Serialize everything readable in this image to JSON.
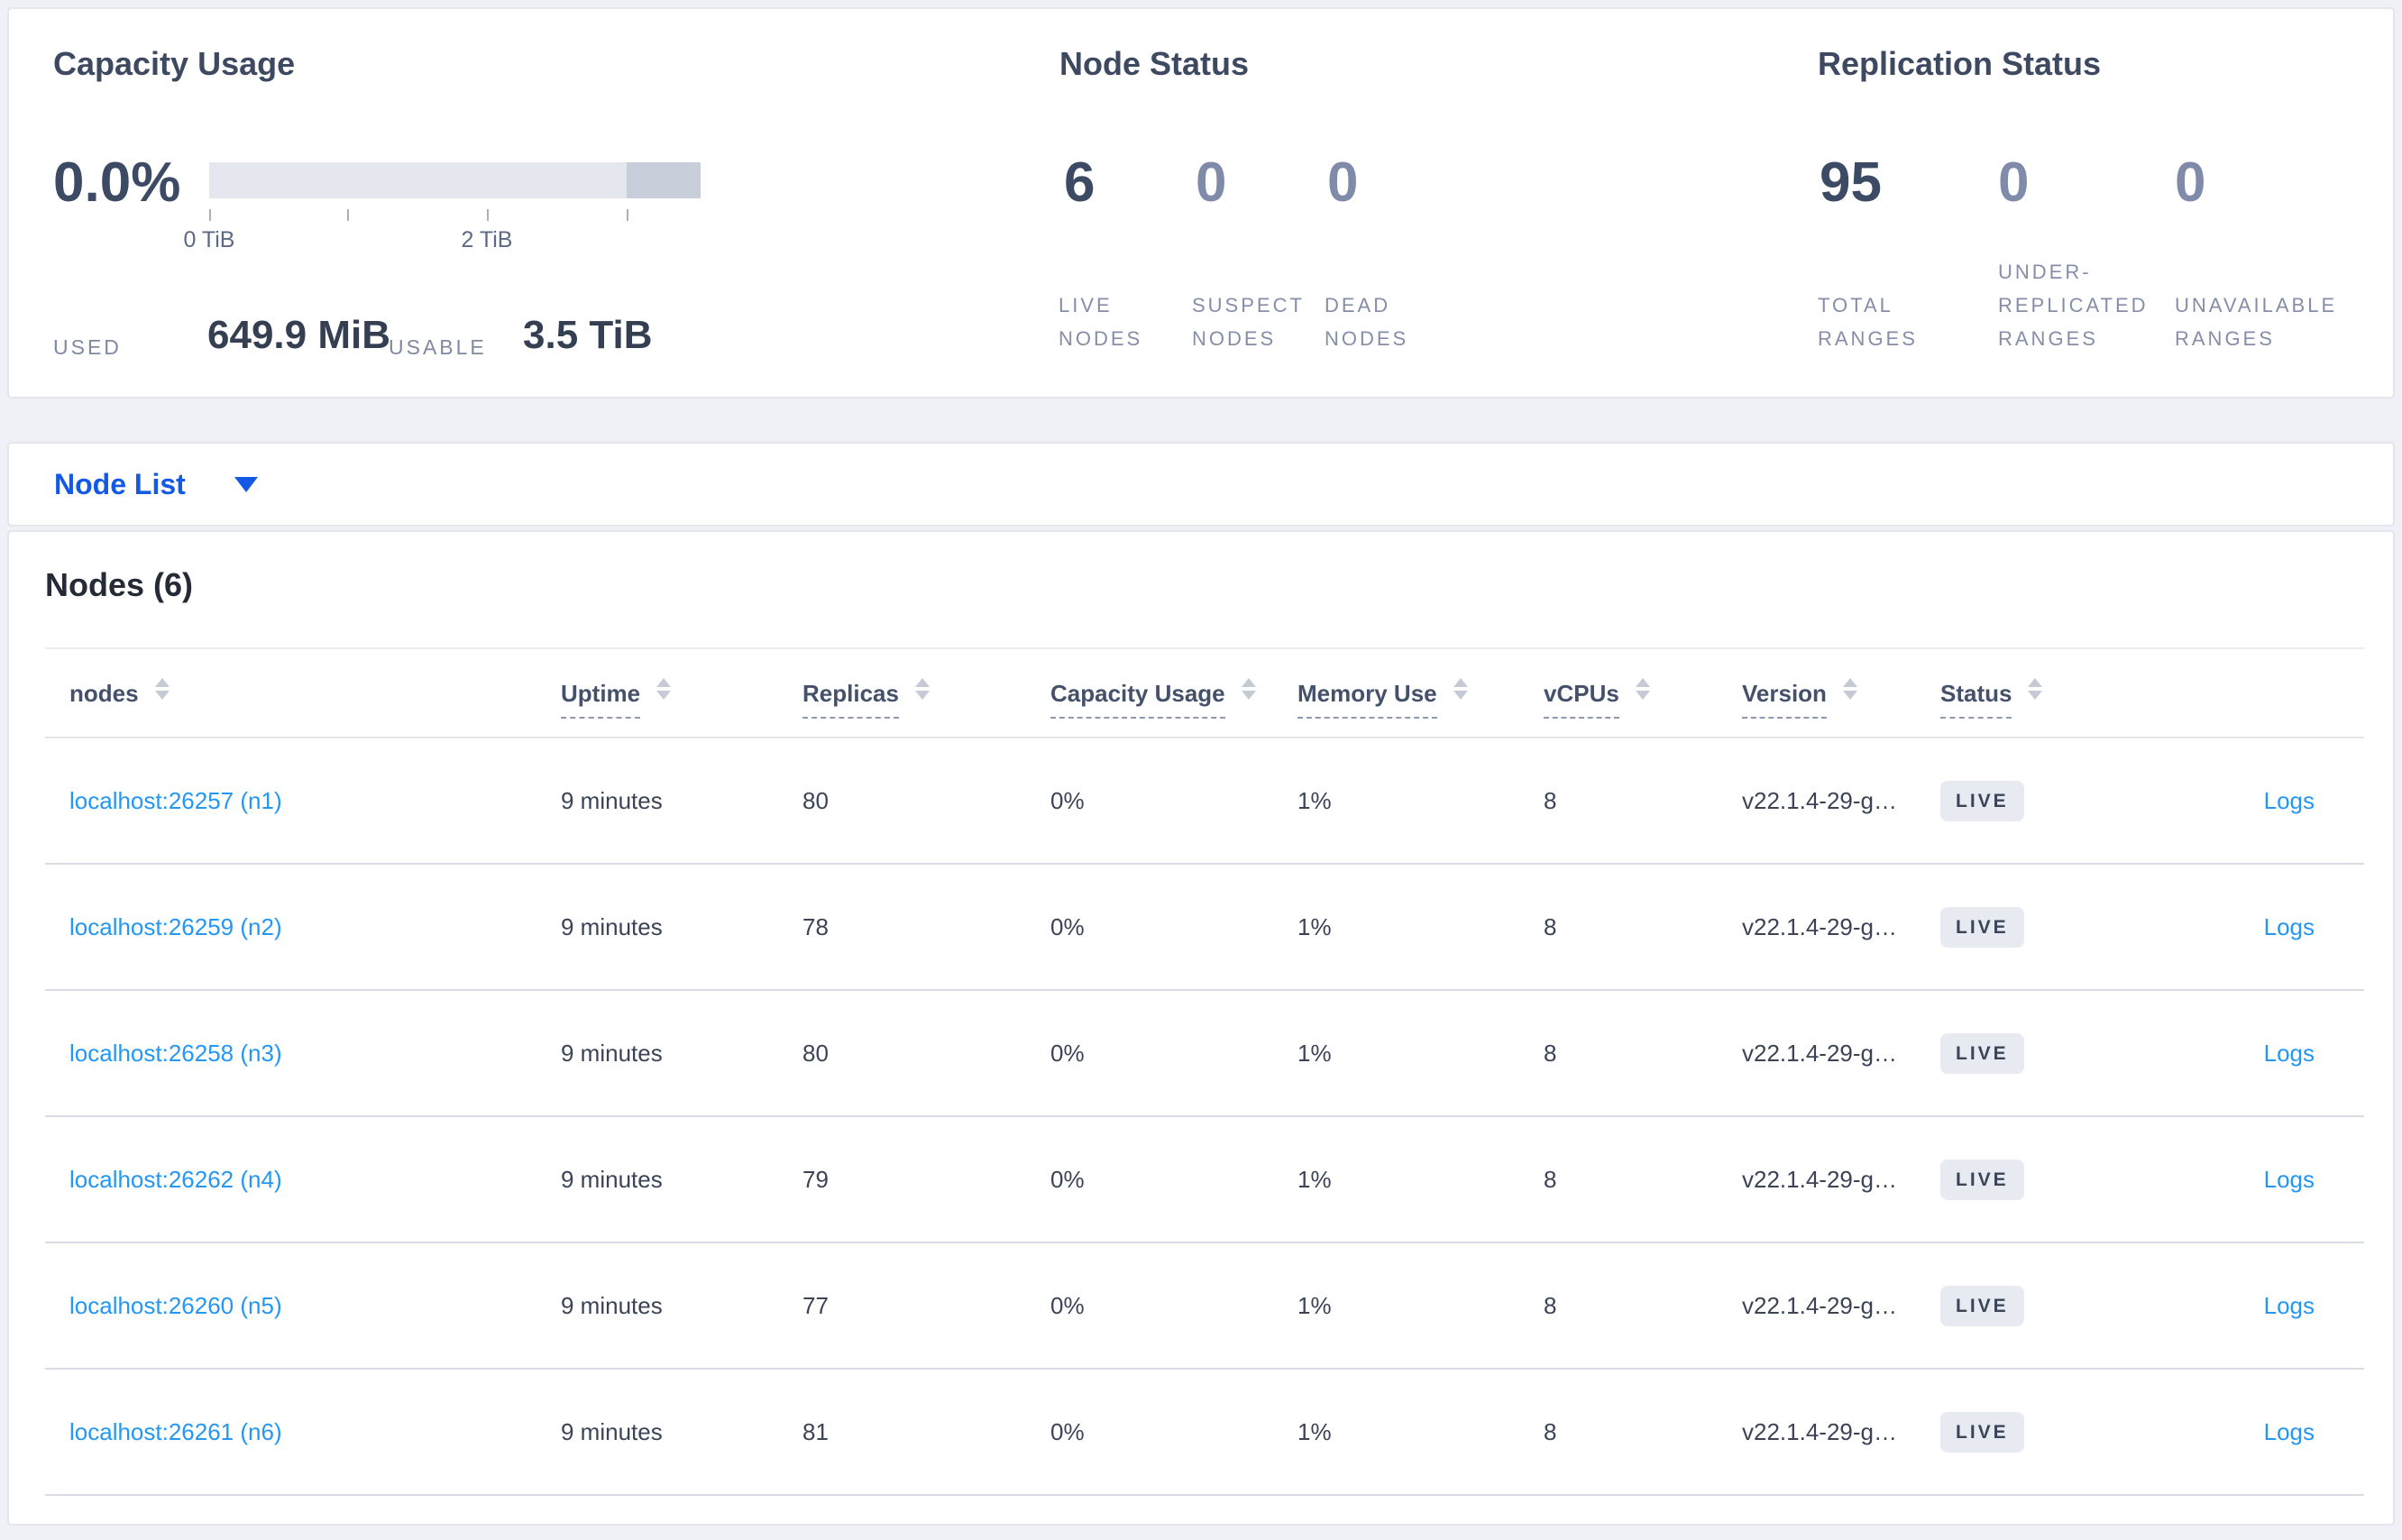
{
  "summary": {
    "capacity": {
      "title": "Capacity Usage",
      "percent": "0.0%",
      "tick_labels": [
        "0 TiB",
        "2 TiB"
      ],
      "used_label": "USED",
      "used_value": "649.9 MiB",
      "usable_label": "USABLE",
      "usable_value": "3.5 TiB"
    },
    "node_status": {
      "title": "Node Status",
      "stats": [
        {
          "value": "6",
          "label": "LIVE NODES"
        },
        {
          "value": "0",
          "label": "SUSPECT NODES"
        },
        {
          "value": "0",
          "label": "DEAD NODES"
        }
      ]
    },
    "replication": {
      "title": "Replication Status",
      "stats": [
        {
          "value": "95",
          "label": "TOTAL RANGES"
        },
        {
          "value": "0",
          "label": "UNDER-REPLICATED RANGES"
        },
        {
          "value": "0",
          "label": "UNAVAILABLE RANGES"
        }
      ]
    }
  },
  "view_selector": {
    "label": "Node List"
  },
  "nodes_table": {
    "title": "Nodes (6)",
    "columns": [
      "nodes",
      "Uptime",
      "Replicas",
      "Capacity Usage",
      "Memory Use",
      "vCPUs",
      "Version",
      "Status"
    ],
    "rows": [
      {
        "node": "localhost:26257 (n1)",
        "uptime": "9 minutes",
        "replicas": "80",
        "capacity": "0%",
        "memory": "1%",
        "vcpus": "8",
        "version": "v22.1.4-29-g…",
        "status": "LIVE",
        "logs": "Logs"
      },
      {
        "node": "localhost:26259 (n2)",
        "uptime": "9 minutes",
        "replicas": "78",
        "capacity": "0%",
        "memory": "1%",
        "vcpus": "8",
        "version": "v22.1.4-29-g…",
        "status": "LIVE",
        "logs": "Logs"
      },
      {
        "node": "localhost:26258 (n3)",
        "uptime": "9 minutes",
        "replicas": "80",
        "capacity": "0%",
        "memory": "1%",
        "vcpus": "8",
        "version": "v22.1.4-29-g…",
        "status": "LIVE",
        "logs": "Logs"
      },
      {
        "node": "localhost:26262 (n4)",
        "uptime": "9 minutes",
        "replicas": "79",
        "capacity": "0%",
        "memory": "1%",
        "vcpus": "8",
        "version": "v22.1.4-29-g…",
        "status": "LIVE",
        "logs": "Logs"
      },
      {
        "node": "localhost:26260 (n5)",
        "uptime": "9 minutes",
        "replicas": "77",
        "capacity": "0%",
        "memory": "1%",
        "vcpus": "8",
        "version": "v22.1.4-29-g…",
        "status": "LIVE",
        "logs": "Logs"
      },
      {
        "node": "localhost:26261 (n6)",
        "uptime": "9 minutes",
        "replicas": "81",
        "capacity": "0%",
        "memory": "1%",
        "vcpus": "8",
        "version": "v22.1.4-29-g…",
        "status": "LIVE",
        "logs": "Logs"
      }
    ]
  },
  "colors": {
    "accent_blue": "#1359e6",
    "link_blue": "#2397f3",
    "dark_number": "#3d4a63",
    "muted_number": "#7f8ba9",
    "badge_bg": "#e7eaf1",
    "bar_track": "#e4e7ee",
    "bar_tail": "#c9cedb"
  }
}
